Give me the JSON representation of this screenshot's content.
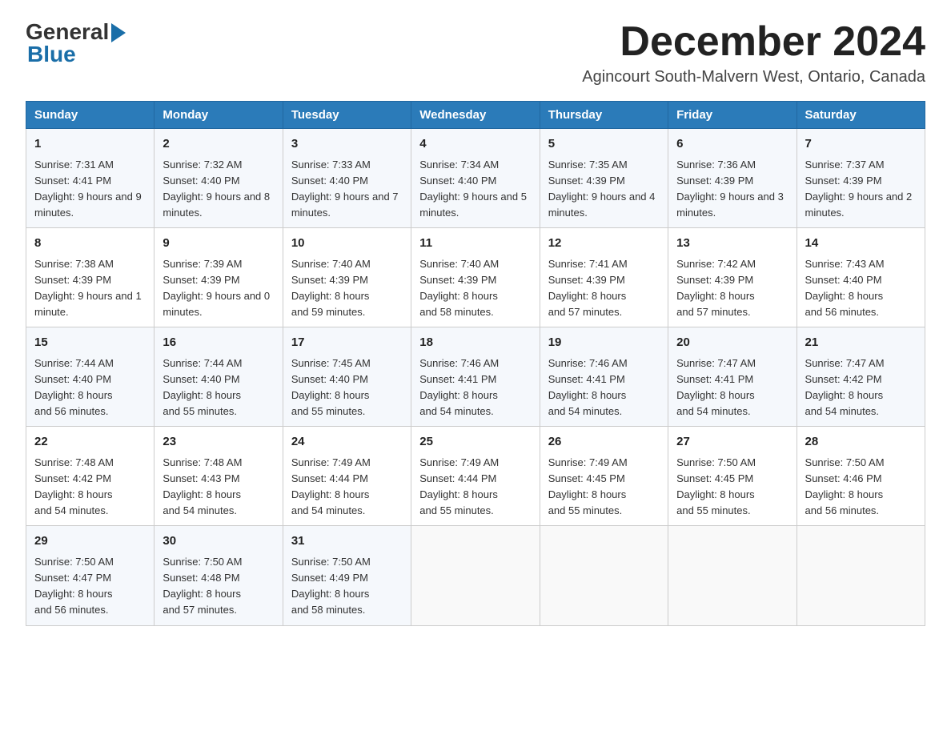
{
  "logo": {
    "general": "General",
    "arrow": "",
    "blue": "Blue"
  },
  "title": "December 2024",
  "subtitle": "Agincourt South-Malvern West, Ontario, Canada",
  "days_header": [
    "Sunday",
    "Monday",
    "Tuesday",
    "Wednesday",
    "Thursday",
    "Friday",
    "Saturday"
  ],
  "weeks": [
    [
      {
        "day": "1",
        "sunrise": "7:31 AM",
        "sunset": "4:41 PM",
        "daylight": "9 hours and 9 minutes."
      },
      {
        "day": "2",
        "sunrise": "7:32 AM",
        "sunset": "4:40 PM",
        "daylight": "9 hours and 8 minutes."
      },
      {
        "day": "3",
        "sunrise": "7:33 AM",
        "sunset": "4:40 PM",
        "daylight": "9 hours and 7 minutes."
      },
      {
        "day": "4",
        "sunrise": "7:34 AM",
        "sunset": "4:40 PM",
        "daylight": "9 hours and 5 minutes."
      },
      {
        "day": "5",
        "sunrise": "7:35 AM",
        "sunset": "4:39 PM",
        "daylight": "9 hours and 4 minutes."
      },
      {
        "day": "6",
        "sunrise": "7:36 AM",
        "sunset": "4:39 PM",
        "daylight": "9 hours and 3 minutes."
      },
      {
        "day": "7",
        "sunrise": "7:37 AM",
        "sunset": "4:39 PM",
        "daylight": "9 hours and 2 minutes."
      }
    ],
    [
      {
        "day": "8",
        "sunrise": "7:38 AM",
        "sunset": "4:39 PM",
        "daylight": "9 hours and 1 minute."
      },
      {
        "day": "9",
        "sunrise": "7:39 AM",
        "sunset": "4:39 PM",
        "daylight": "9 hours and 0 minutes."
      },
      {
        "day": "10",
        "sunrise": "7:40 AM",
        "sunset": "4:39 PM",
        "daylight": "8 hours and 59 minutes."
      },
      {
        "day": "11",
        "sunrise": "7:40 AM",
        "sunset": "4:39 PM",
        "daylight": "8 hours and 58 minutes."
      },
      {
        "day": "12",
        "sunrise": "7:41 AM",
        "sunset": "4:39 PM",
        "daylight": "8 hours and 57 minutes."
      },
      {
        "day": "13",
        "sunrise": "7:42 AM",
        "sunset": "4:39 PM",
        "daylight": "8 hours and 57 minutes."
      },
      {
        "day": "14",
        "sunrise": "7:43 AM",
        "sunset": "4:40 PM",
        "daylight": "8 hours and 56 minutes."
      }
    ],
    [
      {
        "day": "15",
        "sunrise": "7:44 AM",
        "sunset": "4:40 PM",
        "daylight": "8 hours and 56 minutes."
      },
      {
        "day": "16",
        "sunrise": "7:44 AM",
        "sunset": "4:40 PM",
        "daylight": "8 hours and 55 minutes."
      },
      {
        "day": "17",
        "sunrise": "7:45 AM",
        "sunset": "4:40 PM",
        "daylight": "8 hours and 55 minutes."
      },
      {
        "day": "18",
        "sunrise": "7:46 AM",
        "sunset": "4:41 PM",
        "daylight": "8 hours and 54 minutes."
      },
      {
        "day": "19",
        "sunrise": "7:46 AM",
        "sunset": "4:41 PM",
        "daylight": "8 hours and 54 minutes."
      },
      {
        "day": "20",
        "sunrise": "7:47 AM",
        "sunset": "4:41 PM",
        "daylight": "8 hours and 54 minutes."
      },
      {
        "day": "21",
        "sunrise": "7:47 AM",
        "sunset": "4:42 PM",
        "daylight": "8 hours and 54 minutes."
      }
    ],
    [
      {
        "day": "22",
        "sunrise": "7:48 AM",
        "sunset": "4:42 PM",
        "daylight": "8 hours and 54 minutes."
      },
      {
        "day": "23",
        "sunrise": "7:48 AM",
        "sunset": "4:43 PM",
        "daylight": "8 hours and 54 minutes."
      },
      {
        "day": "24",
        "sunrise": "7:49 AM",
        "sunset": "4:44 PM",
        "daylight": "8 hours and 54 minutes."
      },
      {
        "day": "25",
        "sunrise": "7:49 AM",
        "sunset": "4:44 PM",
        "daylight": "8 hours and 55 minutes."
      },
      {
        "day": "26",
        "sunrise": "7:49 AM",
        "sunset": "4:45 PM",
        "daylight": "8 hours and 55 minutes."
      },
      {
        "day": "27",
        "sunrise": "7:50 AM",
        "sunset": "4:45 PM",
        "daylight": "8 hours and 55 minutes."
      },
      {
        "day": "28",
        "sunrise": "7:50 AM",
        "sunset": "4:46 PM",
        "daylight": "8 hours and 56 minutes."
      }
    ],
    [
      {
        "day": "29",
        "sunrise": "7:50 AM",
        "sunset": "4:47 PM",
        "daylight": "8 hours and 56 minutes."
      },
      {
        "day": "30",
        "sunrise": "7:50 AM",
        "sunset": "4:48 PM",
        "daylight": "8 hours and 57 minutes."
      },
      {
        "day": "31",
        "sunrise": "7:50 AM",
        "sunset": "4:49 PM",
        "daylight": "8 hours and 58 minutes."
      },
      null,
      null,
      null,
      null
    ]
  ],
  "labels": {
    "sunrise": "Sunrise:",
    "sunset": "Sunset:",
    "daylight": "Daylight:"
  }
}
